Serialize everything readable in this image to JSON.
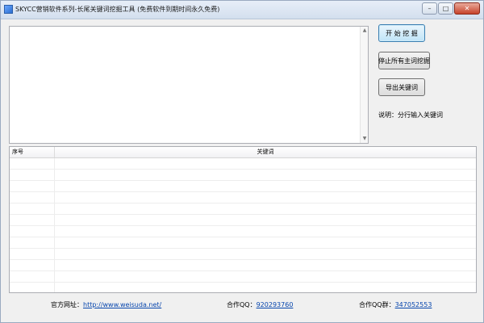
{
  "window": {
    "title": "SKYCC营销软件系列-长尾关键词挖掘工具 (免费软件到期时间永久免费)",
    "minimize_glyph": "–",
    "maximize_glyph": "□",
    "close_glyph": "✕"
  },
  "buttons": {
    "start": "开 始 挖 掘",
    "stop": "停止所有主词挖掘",
    "export": "导出关键词"
  },
  "instruction": "说明：分行输入关键词",
  "table": {
    "columns": [
      "序号",
      "关键词"
    ],
    "rows": []
  },
  "footer": {
    "website_label": "官方网址：",
    "website_url": "http://www.weisuda.net/",
    "qq_label": "合作QQ：",
    "qq_value": "920293760",
    "qq_group_label": "合作QQ群：",
    "qq_group_value": "347052553"
  },
  "icons": [
    "app-icon",
    "scroll-up-icon",
    "scroll-down-icon"
  ],
  "colors": {
    "primary_button": "#bfe4f7",
    "link": "#0645ad",
    "titlebar": "#d3dfee"
  }
}
